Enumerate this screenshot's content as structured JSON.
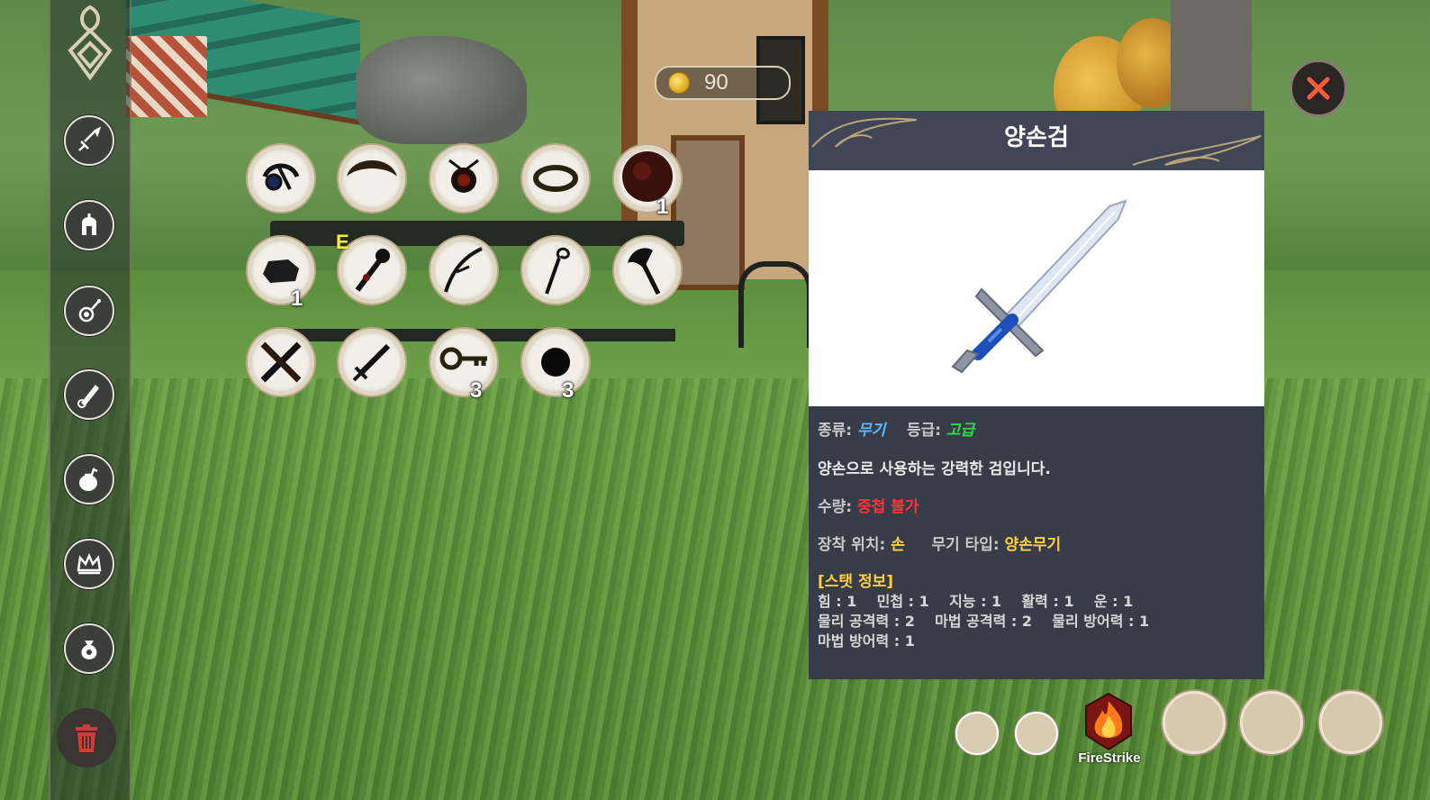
{
  "currency": {
    "gold": "90",
    "icon": "gold-coin-icon"
  },
  "categories": [
    {
      "icon": "sword-icon"
    },
    {
      "icon": "helmet-icon"
    },
    {
      "icon": "necklace-icon"
    },
    {
      "icon": "scroll-icon"
    },
    {
      "icon": "pouch-icon"
    },
    {
      "icon": "crown-icon"
    },
    {
      "icon": "money-bag-icon"
    }
  ],
  "inventory": {
    "equipped_marker": "E",
    "slots": [
      {
        "icon": "eye-amulet-icon",
        "quantity": ""
      },
      {
        "icon": "crescent-icon",
        "quantity": ""
      },
      {
        "icon": "red-gem-necklace-icon",
        "quantity": ""
      },
      {
        "icon": "ring-icon",
        "quantity": ""
      },
      {
        "icon": "dark-orb-icon",
        "quantity": "1"
      },
      {
        "icon": "stone-icon",
        "quantity": "1"
      },
      {
        "icon": "mace-icon",
        "quantity": ""
      },
      {
        "icon": "bow-icon",
        "quantity": ""
      },
      {
        "icon": "staff-icon",
        "quantity": ""
      },
      {
        "icon": "axe-icon",
        "quantity": ""
      },
      {
        "icon": "crossed-clubs-icon",
        "quantity": ""
      },
      {
        "icon": "short-sword-icon",
        "quantity": ""
      },
      {
        "icon": "key-icon",
        "quantity": "3"
      },
      {
        "icon": "black-orb-icon",
        "quantity": "3"
      }
    ]
  },
  "detail": {
    "title": "양손검",
    "image_icon": "greatsword-icon",
    "type_label": "종류:",
    "type_value": "무기",
    "grade_label": "등급:",
    "grade_value": "고급",
    "description": "양손으로 사용하는 강력한 검입니다.",
    "quantity_label": "수량:",
    "quantity_value": "중첩 불가",
    "slot_label": "장착 위치:",
    "slot_value": "손",
    "weapon_type_label": "무기 타입:",
    "weapon_type_value": "양손무기",
    "stats_header": "[스탯 정보]",
    "stats_line1": "힘 : 1    민첩 : 1    지능 : 1    활력 : 1    운 : 1",
    "stats_line2": "물리 공격력 : 2    마법 공격력 : 2    물리 방어력 : 1",
    "stats_line3": "마법 방어력 : 1"
  },
  "skillbar": {
    "skill_name": "FireStrike",
    "skill_icon": "fire-icon"
  },
  "colors": {
    "panel_bg": "#373c48",
    "grade_green": "#2fd94a",
    "type_blue": "#62b6ff",
    "warn_red": "#ff3434",
    "accent_yellow": "#ffd23a",
    "close_red": "#ff5a3a"
  }
}
